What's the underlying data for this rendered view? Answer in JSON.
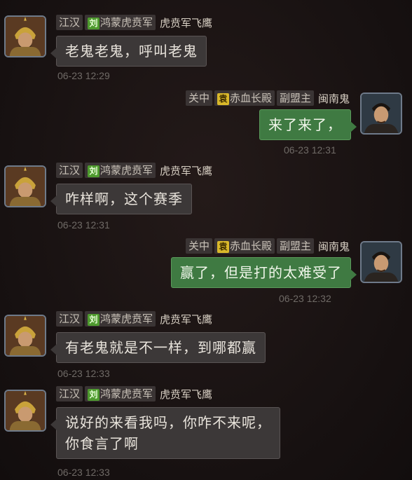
{
  "messages": [
    {
      "side": "left",
      "region": "江汉",
      "badge": "刘",
      "alliance": "鸿蒙虎贲军",
      "sender": "虎贲军飞鹰",
      "text_lines": [
        "老鬼老鬼，呼叫老鬼"
      ],
      "time": "06-23 12:29"
    },
    {
      "side": "right",
      "region": "关中",
      "badge": "袁",
      "alliance": "赤血长殿",
      "role": "副盟主",
      "sender": "闽南鬼",
      "text_lines": [
        "来了来了，"
      ],
      "time": "06-23 12:31"
    },
    {
      "side": "left",
      "region": "江汉",
      "badge": "刘",
      "alliance": "鸿蒙虎贲军",
      "sender": "虎贲军飞鹰",
      "text_lines": [
        "咋样啊，这个赛季"
      ],
      "time": "06-23 12:31"
    },
    {
      "side": "right",
      "region": "关中",
      "badge": "袁",
      "alliance": "赤血长殿",
      "role": "副盟主",
      "sender": "闽南鬼",
      "text_lines": [
        "赢了，但是打的太难受了"
      ],
      "time": "06-23 12:32"
    },
    {
      "side": "left",
      "region": "江汉",
      "badge": "刘",
      "alliance": "鸿蒙虎贲军",
      "sender": "虎贲军飞鹰",
      "text_lines": [
        "有老鬼就是不一样，到哪都赢"
      ],
      "time": "06-23 12:33"
    },
    {
      "side": "left",
      "region": "江汉",
      "badge": "刘",
      "alliance": "鸿蒙虎贲军",
      "sender": "虎贲军飞鹰",
      "text_lines": [
        "说好的来看我吗，你咋不来呢，",
        "你食言了啊"
      ],
      "time": "06-23 12:33"
    }
  ],
  "colors": {
    "background": "#1c1515",
    "left_bubble": "#3c3838",
    "right_bubble": "#3f7a42",
    "badge_liu": "#4e9a2e",
    "badge_yuan": "#d9b82a"
  },
  "icons": {
    "left_avatar": "armored-general-portrait",
    "right_avatar": "young-officer-portrait"
  }
}
